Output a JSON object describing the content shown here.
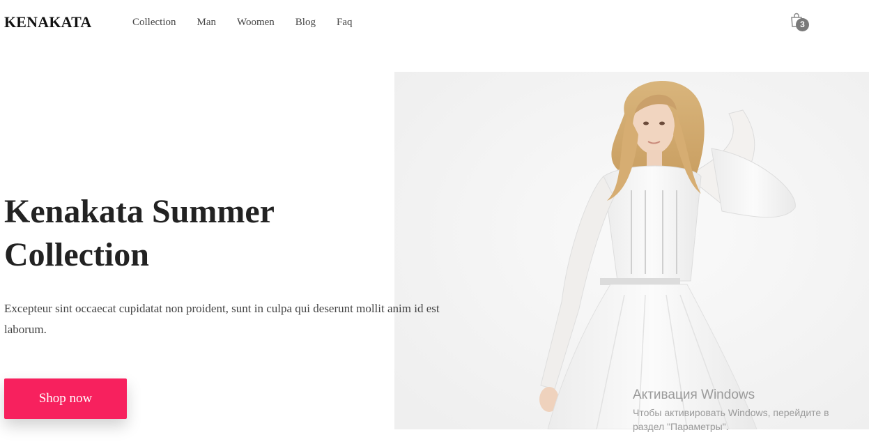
{
  "header": {
    "logo": "KENAKATA",
    "nav": [
      {
        "label": "Collection"
      },
      {
        "label": "Man"
      },
      {
        "label": "Woomen"
      },
      {
        "label": "Blog"
      },
      {
        "label": "Faq"
      }
    ],
    "cart": {
      "icon": "shopping-bag-icon",
      "count": "3"
    }
  },
  "hero": {
    "title_line1": "Kenakata Summer",
    "title_line2": "Collection",
    "description": "Excepteur sint occaecat cupidatat non proident, sunt in culpa qui deserunt mollit anim id est laborum.",
    "button_label": "Shop now",
    "image": "woman-in-white-dress-photo"
  },
  "watermark": {
    "title": "Активация Windows",
    "subtitle": "Чтобы активировать Windows, перейдите в раздел \"Параметры\"."
  },
  "colors": {
    "accent": "#f7215e",
    "badge": "#7a7a7a",
    "text": "#222222"
  }
}
